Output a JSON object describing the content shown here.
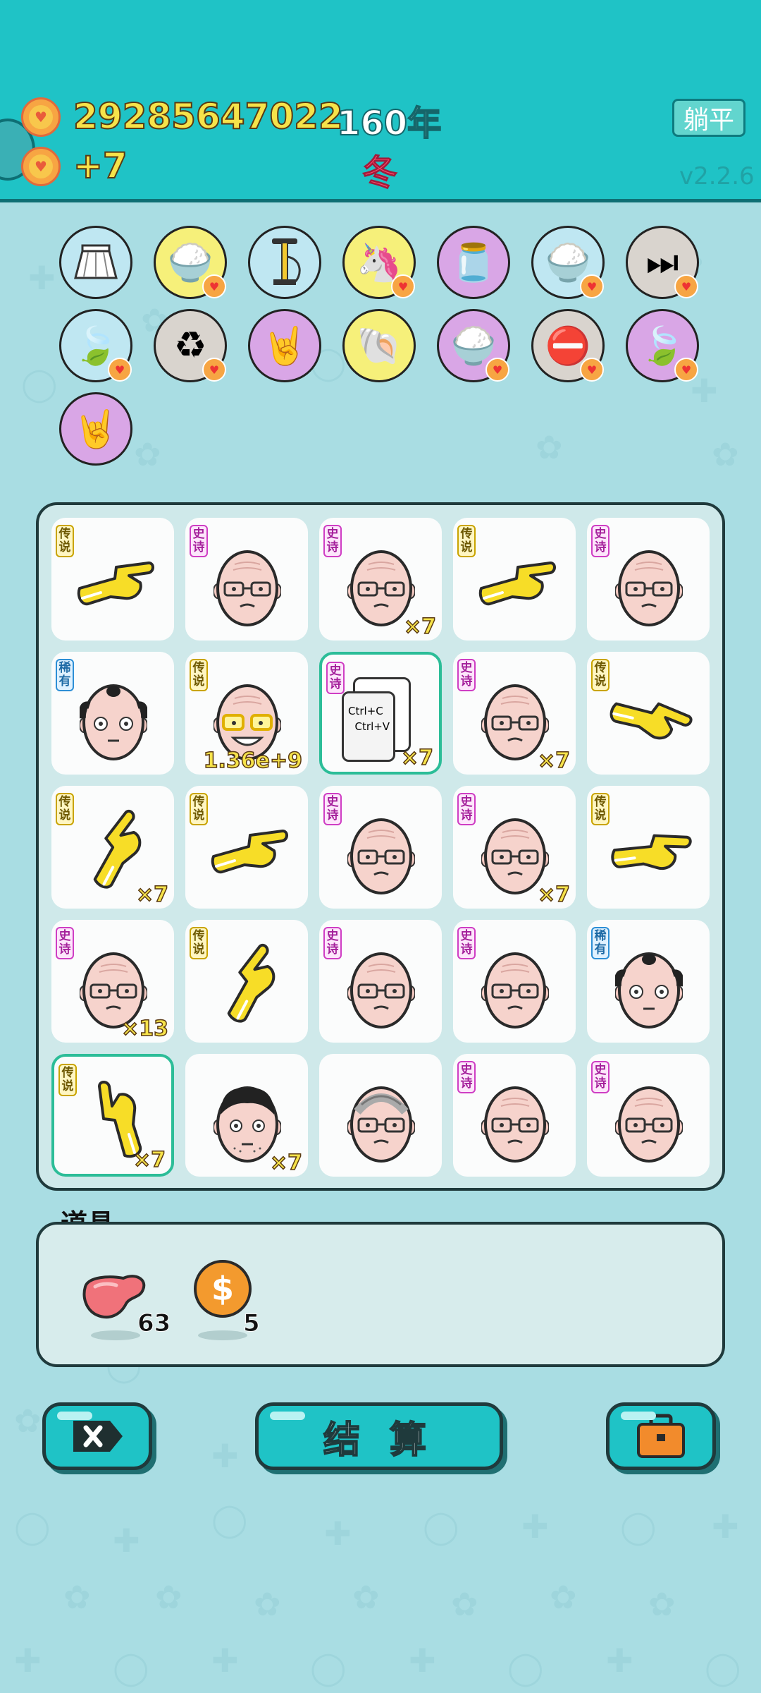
{
  "header": {
    "money": "29285647022",
    "income": "+7",
    "year": "160年",
    "season": "冬",
    "lie_ping": "躺平",
    "version": "v2.2.6"
  },
  "relics": [
    {
      "name": "skirt",
      "bg": "#bfe7f2"
    },
    {
      "name": "rice-bowl",
      "bg": "#f6f07a",
      "heart": true
    },
    {
      "name": "pump",
      "bg": "#bfe7f2"
    },
    {
      "name": "unicorn",
      "bg": "#f6f07a",
      "heart": true
    },
    {
      "name": "jar",
      "bg": "#d9a6e6"
    },
    {
      "name": "rice-bowl",
      "bg": "#bfe7f2",
      "heart": true
    },
    {
      "name": "skip",
      "bg": "#d9d4ce",
      "heart": true
    },
    {
      "name": "leaf",
      "bg": "#bfe7f2",
      "heart": true
    },
    {
      "name": "recycle",
      "bg": "#d9d4ce",
      "heart": true
    },
    {
      "name": "rock-hand",
      "bg": "#d9a6e6"
    },
    {
      "name": "shell",
      "bg": "#f6f07a"
    },
    {
      "name": "rice-bowl",
      "bg": "#d9a6e6",
      "heart": true
    },
    {
      "name": "no-entry",
      "bg": "#d9d4ce",
      "heart": true
    },
    {
      "name": "leaf",
      "bg": "#d9a6e6",
      "heart": true
    },
    {
      "name": "rock-hand",
      "bg": "#d9a6e6"
    }
  ],
  "board": [
    [
      {
        "type": "hand",
        "tag": "传说",
        "rar": "leg",
        "mult": "",
        "rot": 0
      },
      {
        "type": "face",
        "tag": "史诗",
        "rar": "epic",
        "mult": ""
      },
      {
        "type": "face",
        "tag": "史诗",
        "rar": "epic",
        "mult": "×7"
      },
      {
        "type": "hand",
        "tag": "传说",
        "rar": "leg",
        "mult": "",
        "rot": 0
      },
      {
        "type": "face",
        "tag": "史诗",
        "rar": "epic",
        "mult": ""
      }
    ],
    [
      {
        "type": "face2",
        "tag": "稀有",
        "rar": "rare",
        "mult": ""
      },
      {
        "type": "grin",
        "tag": "传说",
        "rar": "leg",
        "mult": "1.36e+9"
      },
      {
        "type": "copy",
        "tag": "史诗",
        "rar": "epic",
        "mult": "×7",
        "sel": true
      },
      {
        "type": "face",
        "tag": "史诗",
        "rar": "epic",
        "mult": "×7"
      },
      {
        "type": "hand",
        "tag": "传说",
        "rar": "leg",
        "mult": "",
        "rot": 30
      }
    ],
    [
      {
        "type": "hand",
        "tag": "传说",
        "rar": "leg",
        "mult": "×7",
        "rot": -45
      },
      {
        "type": "hand",
        "tag": "传说",
        "rar": "leg",
        "mult": "",
        "rot": 0
      },
      {
        "type": "face",
        "tag": "史诗",
        "rar": "epic",
        "mult": ""
      },
      {
        "type": "face",
        "tag": "史诗",
        "rar": "epic",
        "mult": "×7"
      },
      {
        "type": "hand",
        "tag": "传说",
        "rar": "leg",
        "mult": "",
        "rot": 10
      }
    ],
    [
      {
        "type": "face",
        "tag": "史诗",
        "rar": "epic",
        "mult": "×13"
      },
      {
        "type": "hand",
        "tag": "传说",
        "rar": "leg",
        "mult": "",
        "rot": -45
      },
      {
        "type": "face",
        "tag": "史诗",
        "rar": "epic",
        "mult": ""
      },
      {
        "type": "face",
        "tag": "史诗",
        "rar": "epic",
        "mult": ""
      },
      {
        "type": "face2",
        "tag": "稀有",
        "rar": "rare",
        "mult": ""
      }
    ],
    [
      {
        "type": "hand",
        "tag": "传说",
        "rar": "leg",
        "mult": "×7",
        "rot": -90,
        "sel": true
      },
      {
        "type": "face3",
        "tag": "",
        "rar": "",
        "mult": "×7"
      },
      {
        "type": "face4",
        "tag": "",
        "rar": "",
        "mult": ""
      },
      {
        "type": "face",
        "tag": "史诗",
        "rar": "epic",
        "mult": ""
      },
      {
        "type": "face",
        "tag": "史诗",
        "rar": "epic",
        "mult": ""
      }
    ]
  ],
  "copy_card": {
    "line1": "Ctrl+C",
    "line2": "Ctrl+V"
  },
  "props": {
    "title": "道具",
    "items": [
      {
        "name": "liver",
        "count": "63"
      },
      {
        "name": "coin",
        "count": "5"
      }
    ]
  },
  "buttons": {
    "settle": "结 算"
  }
}
